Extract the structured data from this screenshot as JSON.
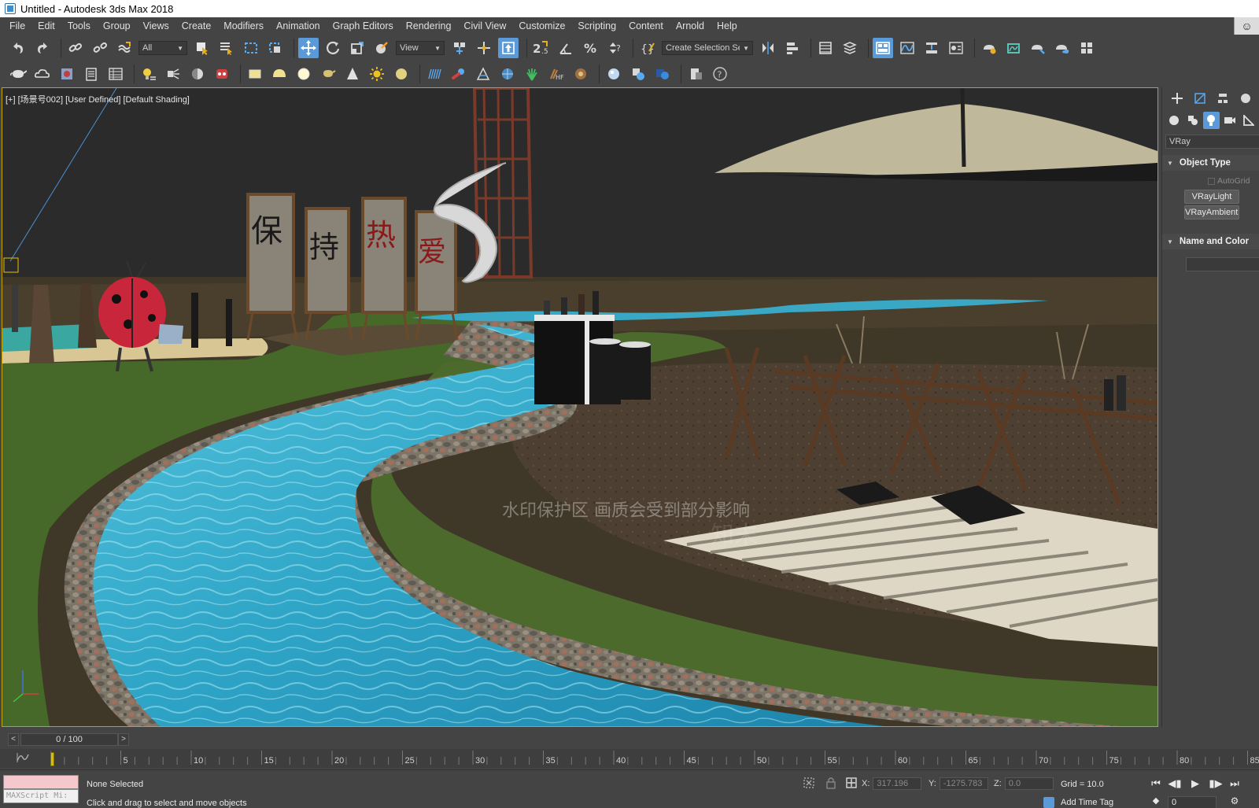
{
  "window": {
    "title": "Untitled - Autodesk 3ds Max 2018"
  },
  "menu": [
    "File",
    "Edit",
    "Tools",
    "Group",
    "Views",
    "Create",
    "Modifiers",
    "Animation",
    "Graph Editors",
    "Rendering",
    "Civil View",
    "Customize",
    "Scripting",
    "Content",
    "Arnold",
    "Help"
  ],
  "toolbar": {
    "selection_filter": "All",
    "reference_coord": "View",
    "named_selection": "Create Selection Set"
  },
  "viewport": {
    "label": "[+] [场景号002] [User Defined] [Default Shading]",
    "banner_chars": [
      "保",
      "持",
      "热",
      "爱"
    ],
    "watermark_notice": "水印保护区  画质会受到部分影响",
    "watermark_brand": "知末"
  },
  "command_panel": {
    "category_dropdown": "VRay",
    "object_type_title": "Object Type",
    "autogrid_label": "AutoGrid",
    "object_buttons": [
      "VRayLight",
      "VRayAmbientLight"
    ],
    "name_color_title": "Name and Color"
  },
  "time_slider": {
    "position": "0 / 100"
  },
  "track_bar": {
    "ticks": [
      "5",
      "10",
      "15",
      "20",
      "25",
      "30",
      "35",
      "40",
      "45",
      "50",
      "55",
      "60",
      "65",
      "70",
      "75",
      "80",
      "85"
    ]
  },
  "status": {
    "maxscript_placeholder": "MAXScript Mi:",
    "selection": "None Selected",
    "prompt": "Click and drag to select and move objects",
    "x_label": "X:",
    "x_value": "317.196",
    "y_label": "Y:",
    "y_value": "-1275.783",
    "z_label": "Z:",
    "z_value": "0.0",
    "grid": "Grid = 10.0",
    "add_time_tag": "Add Time Tag",
    "frame": "0"
  },
  "colors": {
    "accent": "#5a9ad8",
    "viewport_border": "#c2a200",
    "water": "#2fa8c9",
    "grass": "#4c6a2c"
  }
}
